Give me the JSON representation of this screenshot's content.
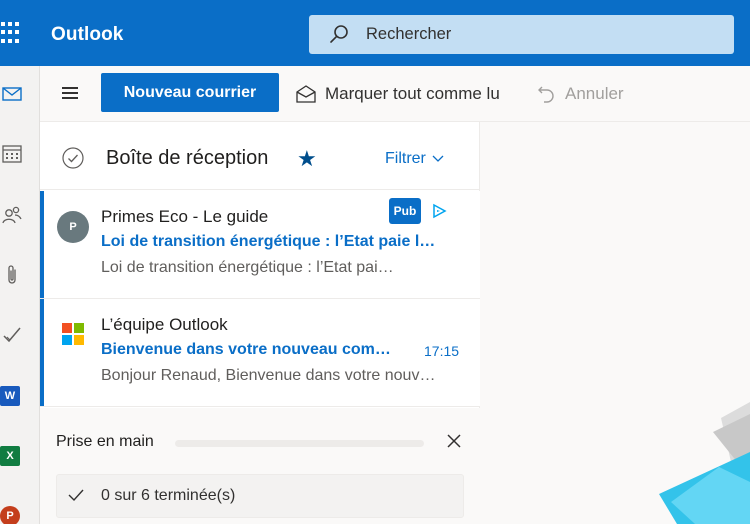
{
  "app": {
    "title": "Outlook"
  },
  "search": {
    "placeholder": "Rechercher"
  },
  "toolbar": {
    "new_mail_label": "Nouveau courrier",
    "mark_all_read_label": "Marquer tout comme lu",
    "undo_label": "Annuler"
  },
  "folder": {
    "title": "Boîte de réception",
    "filter_label": "Filtrer"
  },
  "messages": [
    {
      "avatar_initial": "P",
      "sender": "Primes Eco - Le guide",
      "subject": "Loi de transition énergétique : l’Etat paie l…",
      "preview": "Loi de transition énergétique : l’Etat pai…",
      "badge": "Pub",
      "time": ""
    },
    {
      "avatar_initial": "",
      "sender": "L’équipe Outlook",
      "subject": "Bienvenue dans votre nouveau com…",
      "preview": "Bonjour Renaud, Bienvenue dans votre nouv…",
      "badge": "",
      "time": "17:15"
    }
  ],
  "getting_started": {
    "title": "Prise en main",
    "progress_fraction": 0,
    "status": "0 sur 6 terminée(s)"
  },
  "rail_apps": [
    {
      "letter": "W",
      "color": "#185abd"
    },
    {
      "letter": "X",
      "color": "#107c41"
    },
    {
      "letter": "P",
      "color": "#c43e1c"
    }
  ],
  "colors": {
    "accent": "#0a6ec7",
    "search_bg": "#c3def3",
    "ms_red": "#f25022",
    "ms_green": "#7fba00",
    "ms_blue": "#00a4ef",
    "ms_yellow": "#ffb900"
  }
}
